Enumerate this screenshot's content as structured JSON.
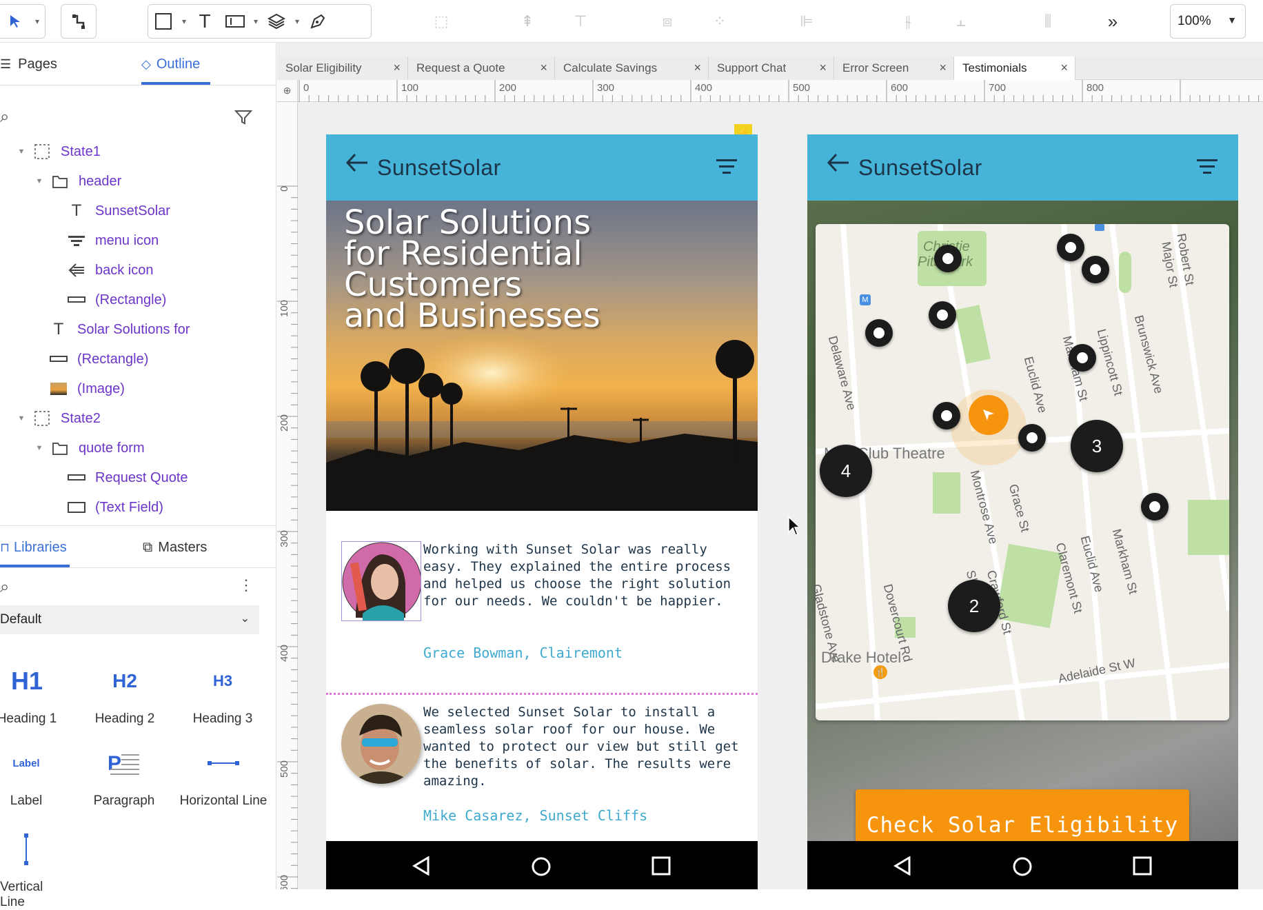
{
  "toolbar": {
    "zoom": "100%",
    "more": "»"
  },
  "left_panel": {
    "tabs": [
      "Pages",
      "Outline"
    ],
    "active_tab": "Outline",
    "outline": [
      {
        "label": "State1",
        "type": "state"
      },
      {
        "label": "header",
        "type": "folder"
      },
      {
        "label": "SunsetSolar",
        "type": "text"
      },
      {
        "label": "menu icon",
        "type": "image"
      },
      {
        "label": "back icon",
        "type": "image"
      },
      {
        "label": "(Rectangle)",
        "type": "rect"
      },
      {
        "label": "Solar Solutions for",
        "type": "text"
      },
      {
        "label": "(Rectangle)",
        "type": "rect"
      },
      {
        "label": "(Image)",
        "type": "image"
      },
      {
        "label": "State2",
        "type": "state"
      },
      {
        "label": "quote form",
        "type": "folder"
      },
      {
        "label": "Request Quote",
        "type": "rect"
      },
      {
        "label": "(Text Field)",
        "type": "field"
      }
    ],
    "lib_tabs": [
      "Libraries",
      "Masters"
    ],
    "library_select": "Default",
    "widgets": [
      {
        "icon": "H1",
        "label": "Heading 1"
      },
      {
        "icon": "H2",
        "label": "Heading 2"
      },
      {
        "icon": "H3",
        "label": "Heading 3"
      },
      {
        "icon": "Label",
        "label": "Label"
      },
      {
        "icon": "paragraph",
        "label": "Paragraph"
      },
      {
        "icon": "hline",
        "label": "Horizontal Line"
      },
      {
        "icon": "vline",
        "label": "Vertical Line"
      }
    ]
  },
  "doc_tabs": [
    "Solar Eligibility",
    "Request a Quote",
    "Calculate Savings",
    "Support Chat",
    "Error Screen",
    "Testimonials"
  ],
  "active_doc_tab": "Testimonials",
  "rulers": {
    "h": [
      "0",
      "100",
      "200",
      "300",
      "400",
      "500",
      "600",
      "700",
      "800"
    ],
    "v": [
      "0",
      "100",
      "200",
      "300",
      "400",
      "500",
      "600"
    ]
  },
  "phone1": {
    "app_title": "SunsetSolar",
    "hero_title": "Solar Solutions\nfor Residential\nCustomers\nand Businesses",
    "testimonials": [
      {
        "text": "Working with Sunset Solar was really easy. They explained the entire process and helped us choose the right solution for our needs. We couldn't be happier.",
        "author": "Grace Bowman, Clairemont"
      },
      {
        "text": "We selected Sunset Solar to install a seamless solar roof for our house. We wanted to protect our view but still get the benefits of solar. The results were amazing.",
        "author": "Mike Casarez, Sunset Cliffs"
      }
    ]
  },
  "phone2": {
    "app_title": "SunsetSolar",
    "map": {
      "streets": [
        "Christie",
        "Pits Park",
        "Robert St",
        "Major St",
        "Delaware Ave",
        "Euclid Ave",
        "Markham St",
        "Lippincott St",
        "Brunswick Ave",
        "Mod Club Theatre",
        "Montrose Ave",
        "Grace St",
        "Shaw St",
        "Crawford St",
        "Claremont St",
        "Euclid Ave",
        "Markham St",
        "Gladstone Ave",
        "Dovercourt Rd",
        "Drake Hotel",
        "Adelaide St W"
      ],
      "clusters": [
        "4",
        "3",
        "2"
      ]
    },
    "cta": "Check Solar Eligibility"
  }
}
